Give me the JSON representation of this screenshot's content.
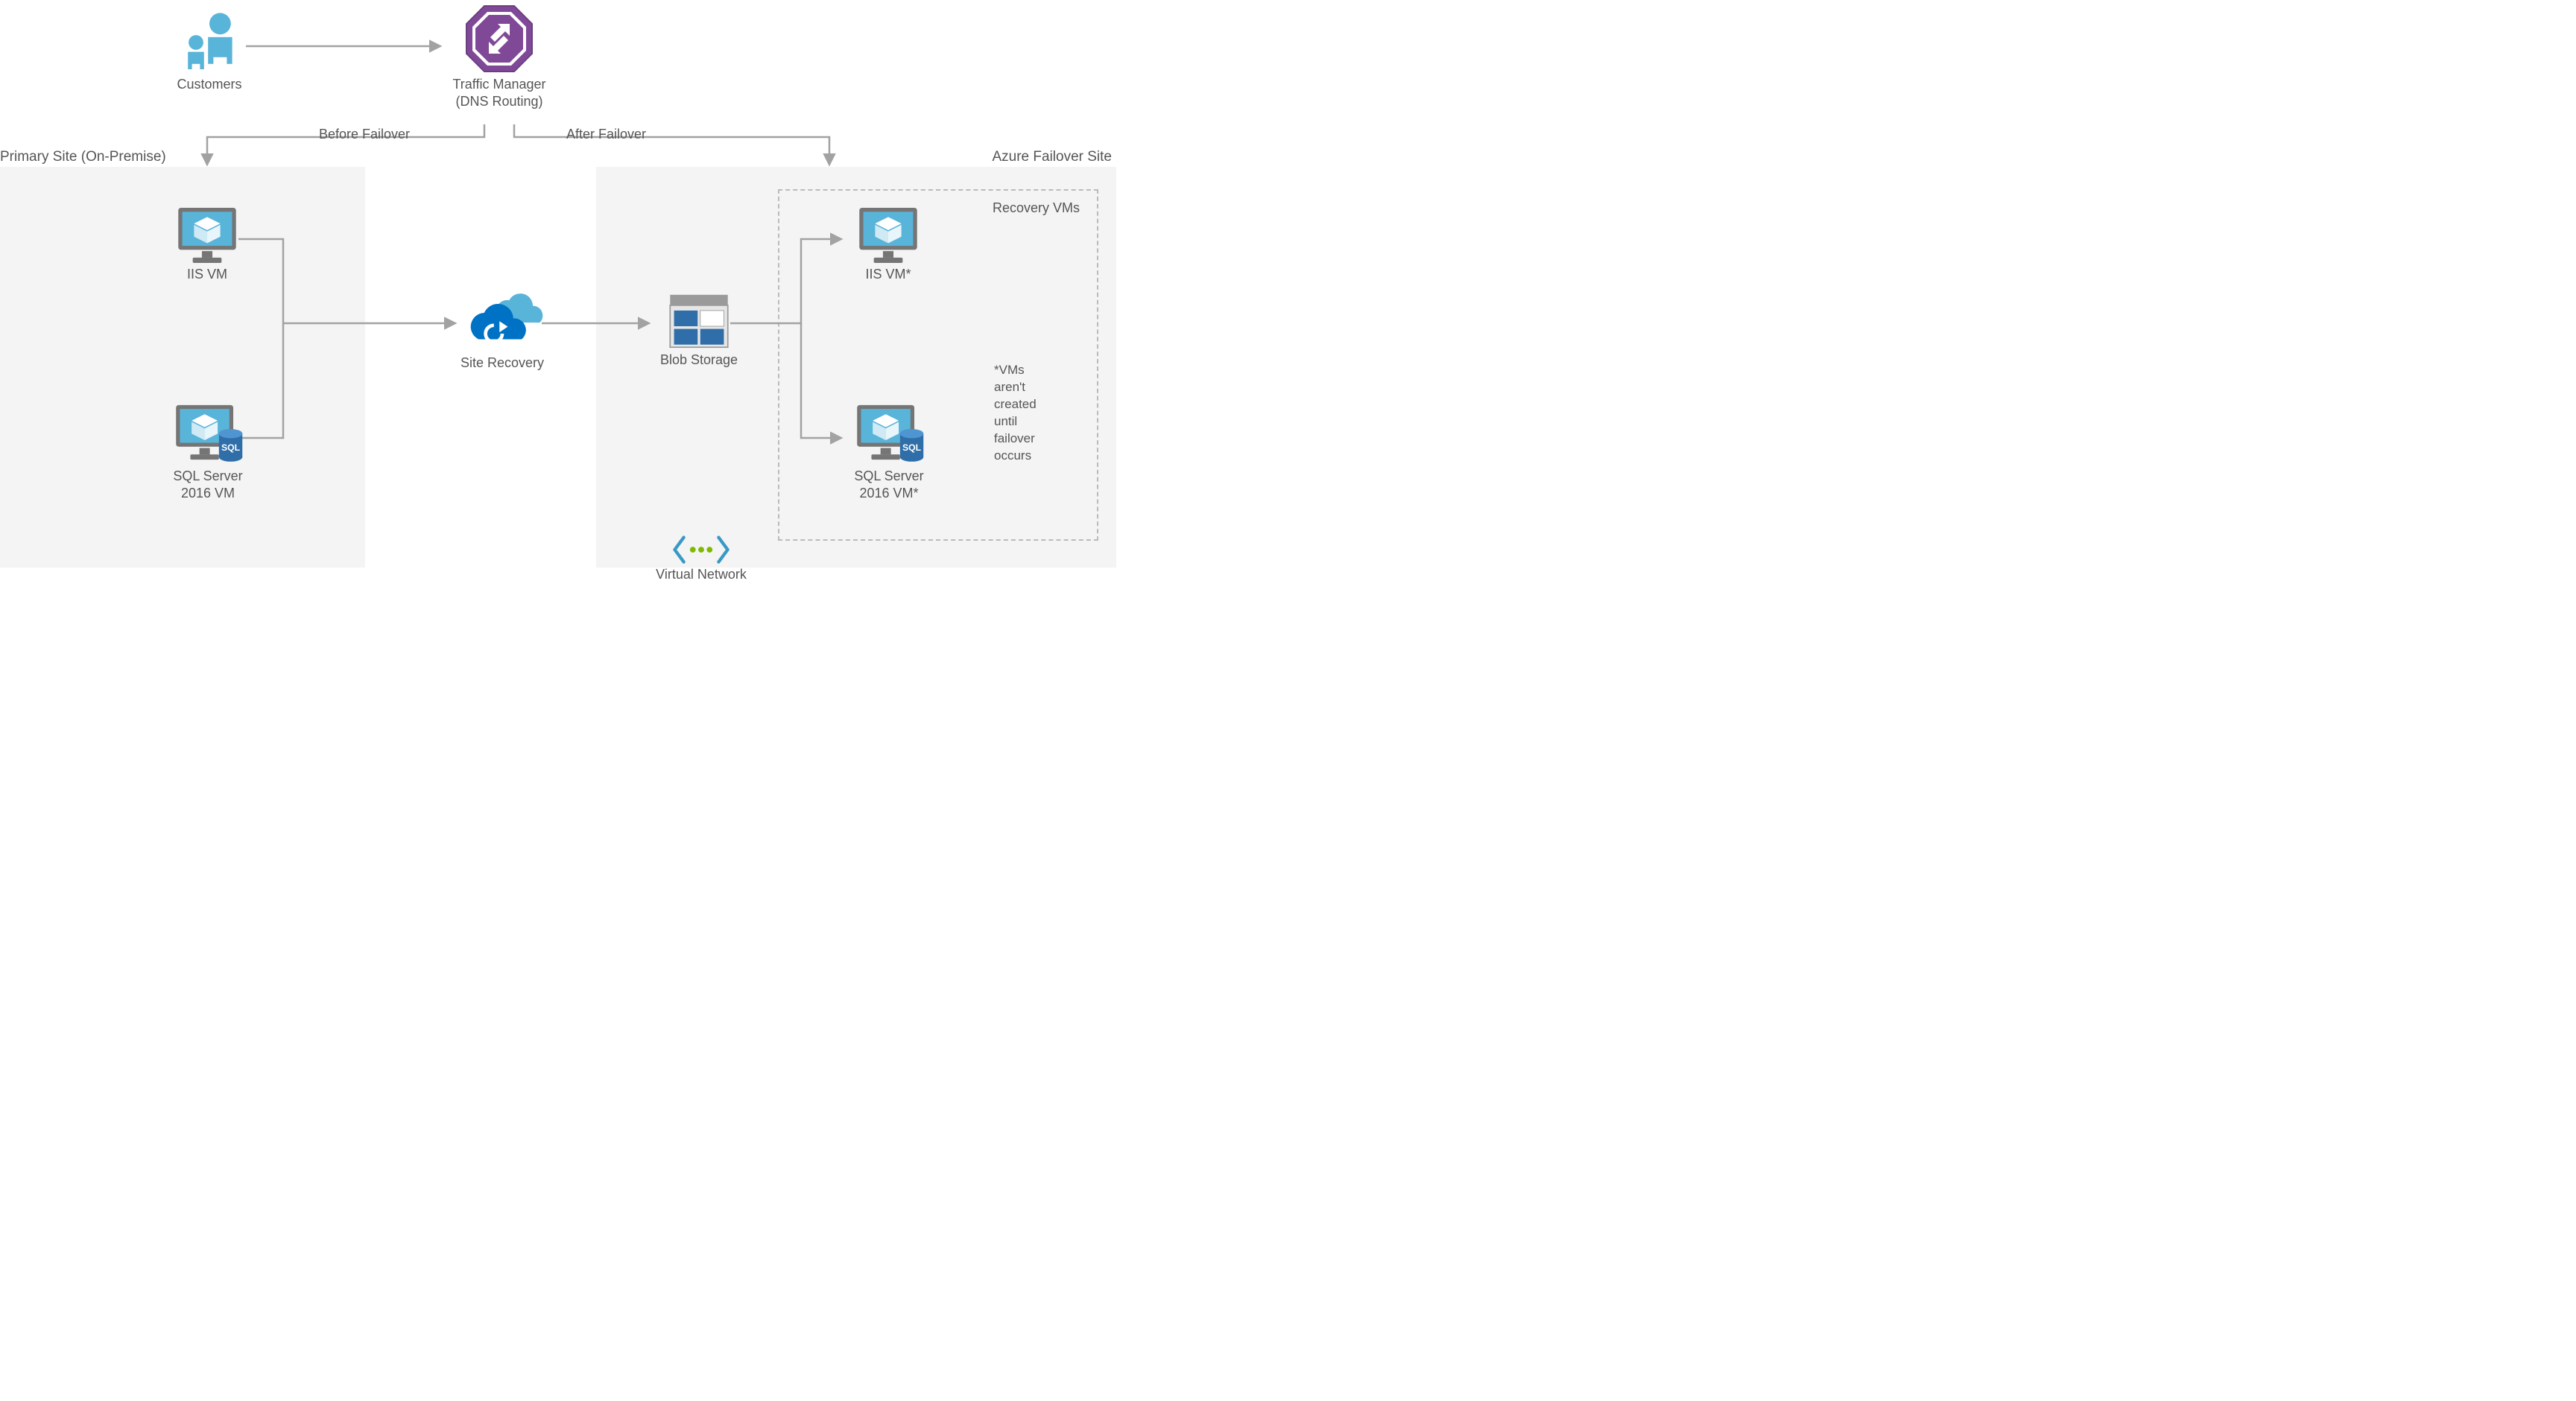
{
  "labels": {
    "customers": "Customers",
    "traffic_manager_l1": "Traffic Manager",
    "traffic_manager_l2": "(DNS Routing)",
    "before_failover": "Before Failover",
    "after_failover": "After Failover",
    "primary_site": "Primary Site (On-Premise)",
    "azure_failover": "Azure Failover Site",
    "iis_vm": "IIS VM",
    "sql_vm_l1": "SQL Server",
    "sql_vm_l2": "2016 VM",
    "site_recovery": "Site Recovery",
    "blob_storage": "Blob Storage",
    "virtual_network": "Virtual Network",
    "recovery_vms": "Recovery VMs",
    "iis_vm_star": "IIS VM*",
    "sql_vm_star_l1": "SQL Server",
    "sql_vm_star_l2": "2016 VM*",
    "note_l1": "*VMs",
    "note_l2": "aren't",
    "note_l3": "created",
    "note_l4": "until",
    "note_l5": "failover",
    "note_l6": "occurs"
  }
}
